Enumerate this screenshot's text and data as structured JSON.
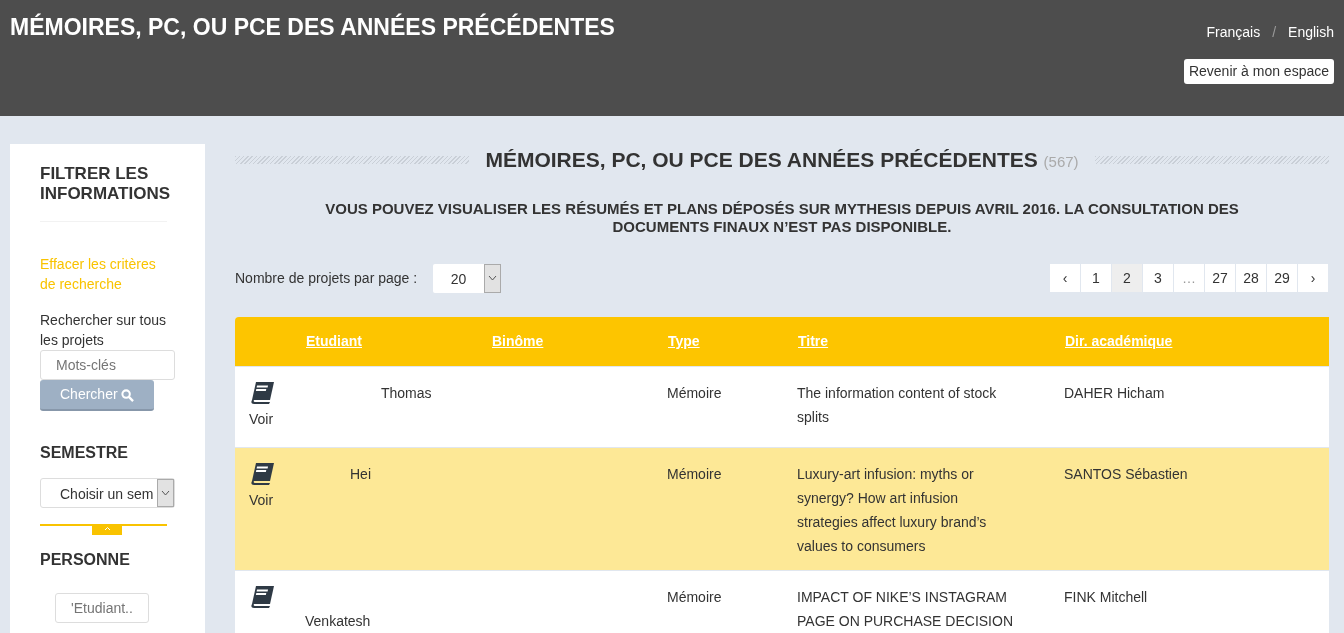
{
  "header": {
    "title": "MÉMOIRES, PC, OU PCE DES ANNÉES PRÉCÉDENTES",
    "languages": [
      {
        "label": "Français",
        "selected": false
      },
      {
        "label": "English",
        "selected": false
      }
    ],
    "separator": "/",
    "back_button": "Revenir à mon espace"
  },
  "sidebar": {
    "title": "FILTRER LES INFORMATIONS",
    "clear_link": "Effacer les critères de recherche",
    "search_label": "Rechercher sur tous les projets",
    "search_placeholder": "Mots-clés",
    "search_button": "Chercher",
    "semester_title": "SEMESTRE",
    "semester_select": "Choisir un sem",
    "person_title": "PERSONNE",
    "person_placeholder": "'Etudiant.."
  },
  "main": {
    "title": "MÉMOIRES, PC, OU PCE DES ANNÉES PRÉCÉDENTES",
    "count": "(567)",
    "notice": "VOUS POUVEZ VISUALISER LES RÉSUMÉS ET PLANS DÉPOSÉS SUR MYTHESIS DEPUIS AVRIL 2016. LA CONSULTATION DES DOCUMENTS FINAUX N’EST PAS DISPONIBLE.",
    "per_page_label": "Nombre de projets par page :",
    "per_page_value": "20",
    "pagination": [
      {
        "label": "‹",
        "kind": "prev",
        "selected": false
      },
      {
        "label": "1",
        "kind": "page",
        "selected": false
      },
      {
        "label": "2",
        "kind": "page",
        "selected": true
      },
      {
        "label": "3",
        "kind": "page",
        "selected": false
      },
      {
        "label": "…",
        "kind": "gap",
        "selected": false
      },
      {
        "label": "27",
        "kind": "page",
        "selected": false
      },
      {
        "label": "28",
        "kind": "page",
        "selected": false
      },
      {
        "label": "29",
        "kind": "page",
        "selected": false
      },
      {
        "label": "›",
        "kind": "next",
        "selected": false
      }
    ]
  },
  "table": {
    "columns": [
      "Etudiant",
      "Binôme",
      "Type",
      "Titre",
      "Dir. académique"
    ],
    "rows": [
      {
        "action": "Voir",
        "student": "Thomas",
        "partner": "",
        "type": "Mémoire",
        "title": "The information content of stock splits",
        "director": "DAHER Hicham",
        "selected": false
      },
      {
        "action": "Voir",
        "student": "Hei",
        "partner": "",
        "type": "Mémoire",
        "title": "Luxury-art infusion: myths or synergy? How art infusion strategies affect luxury brand’s values to consumers",
        "director": "SANTOS Sébastien",
        "selected": true
      },
      {
        "action": "",
        "student": "Venkatesh",
        "partner": "",
        "type": "Mémoire",
        "title": "IMPACT OF NIKE’S INSTAGRAM PAGE ON PURCHASE DECISION",
        "director": "FINK Mitchell",
        "selected": false
      }
    ]
  }
}
